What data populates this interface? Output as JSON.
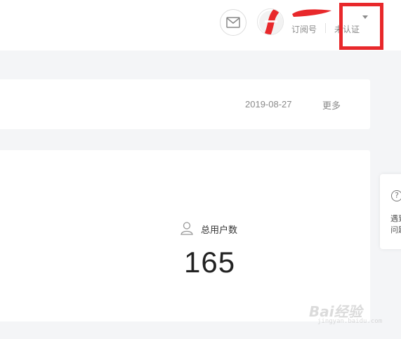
{
  "header": {
    "account_name": "",
    "account_type": "订阅号",
    "account_status": "未认证"
  },
  "icons": {
    "mail": "mail-icon",
    "avatar": "avatar-image",
    "dropdown": "caret-down-icon",
    "user": "user-icon",
    "help": "question-icon"
  },
  "notice": {
    "date": "2019-08-27",
    "more_label": "更多"
  },
  "stats": {
    "total_users_label": "总用户数",
    "total_users_value": "165"
  },
  "help": {
    "icon_glyph": "?",
    "line1": "遇到",
    "line2": "问题"
  },
  "watermark": {
    "text": "Bai经验",
    "sub": "jingyan.baidu.com"
  },
  "colors": {
    "highlight": "#e8282b",
    "redaction": "#e8282b"
  }
}
